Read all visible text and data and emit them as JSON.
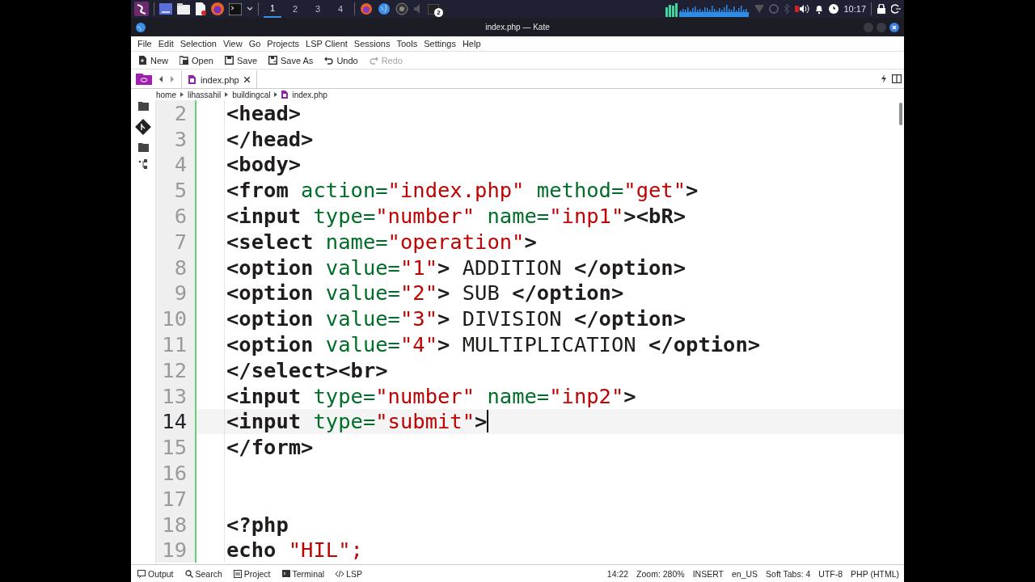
{
  "taskbar": {
    "workspaces": [
      {
        "label": "1",
        "selected": true
      },
      {
        "label": "2",
        "selected": false
      },
      {
        "label": "3",
        "selected": false
      },
      {
        "label": "4",
        "selected": false
      }
    ],
    "task_badge": "2",
    "clock": "10:17"
  },
  "window": {
    "title": "index.php — Kate"
  },
  "menu": [
    "File",
    "Edit",
    "Selection",
    "View",
    "Go",
    "Projects",
    "LSP Client",
    "Sessions",
    "Tools",
    "Settings",
    "Help"
  ],
  "toolbar": [
    {
      "label": "New",
      "disabled": false
    },
    {
      "label": "Open",
      "disabled": false
    },
    {
      "label": "Save",
      "disabled": false
    },
    {
      "label": "Save As",
      "disabled": false
    },
    {
      "label": "Undo",
      "disabled": false
    },
    {
      "label": "Redo",
      "disabled": true
    }
  ],
  "tabs": [
    {
      "label": "index.php",
      "selected": true
    }
  ],
  "breadcrumb": [
    "home",
    "lihassahil",
    "buildingcal",
    "index.php"
  ],
  "editor": {
    "lines": [
      {
        "number": "2",
        "current": false,
        "tokens": [
          {
            "kind": "tag",
            "text": "<head>"
          }
        ]
      },
      {
        "number": "3",
        "current": false,
        "tokens": [
          {
            "kind": "tag",
            "text": "</head>"
          }
        ]
      },
      {
        "number": "4",
        "current": false,
        "tokens": [
          {
            "kind": "tag",
            "text": "<body>"
          }
        ]
      },
      {
        "number": "5",
        "current": false,
        "tokens": [
          {
            "kind": "tag",
            "text": "<from"
          },
          {
            "kind": "attr",
            "text": " action="
          },
          {
            "kind": "str",
            "text": "\"index.php\""
          },
          {
            "kind": "attr",
            "text": " method="
          },
          {
            "kind": "str",
            "text": "\"get\""
          },
          {
            "kind": "tag",
            "text": ">"
          }
        ]
      },
      {
        "number": "6",
        "current": false,
        "tokens": [
          {
            "kind": "tag",
            "text": "<input"
          },
          {
            "kind": "attr",
            "text": " type="
          },
          {
            "kind": "str",
            "text": "\"number\""
          },
          {
            "kind": "attr",
            "text": " name="
          },
          {
            "kind": "str",
            "text": "\"inp1\""
          },
          {
            "kind": "tag",
            "text": "><bR>"
          }
        ]
      },
      {
        "number": "7",
        "current": false,
        "tokens": [
          {
            "kind": "tag",
            "text": "<select"
          },
          {
            "kind": "attr",
            "text": " name="
          },
          {
            "kind": "str",
            "text": "\"operation\""
          },
          {
            "kind": "tag",
            "text": ">"
          }
        ]
      },
      {
        "number": "8",
        "current": false,
        "tokens": [
          {
            "kind": "tag",
            "text": "<option"
          },
          {
            "kind": "attr",
            "text": " value="
          },
          {
            "kind": "str",
            "text": "\"1\""
          },
          {
            "kind": "tag",
            "text": ">"
          },
          {
            "kind": "text",
            "text": " ADDITION "
          },
          {
            "kind": "tag",
            "text": "</option>"
          }
        ]
      },
      {
        "number": "9",
        "current": false,
        "tokens": [
          {
            "kind": "tag",
            "text": "<option"
          },
          {
            "kind": "attr",
            "text": " value="
          },
          {
            "kind": "str",
            "text": "\"2\""
          },
          {
            "kind": "tag",
            "text": ">"
          },
          {
            "kind": "text",
            "text": " SUB "
          },
          {
            "kind": "tag",
            "text": "</option>"
          }
        ]
      },
      {
        "number": "10",
        "current": false,
        "tokens": [
          {
            "kind": "tag",
            "text": "<option"
          },
          {
            "kind": "attr",
            "text": " value="
          },
          {
            "kind": "str",
            "text": "\"3\""
          },
          {
            "kind": "tag",
            "text": ">"
          },
          {
            "kind": "text",
            "text": " DIVISION "
          },
          {
            "kind": "tag",
            "text": "</option>"
          }
        ]
      },
      {
        "number": "11",
        "current": false,
        "tokens": [
          {
            "kind": "tag",
            "text": "<option"
          },
          {
            "kind": "attr",
            "text": " value="
          },
          {
            "kind": "str",
            "text": "\"4\""
          },
          {
            "kind": "tag",
            "text": ">"
          },
          {
            "kind": "text",
            "text": " MULTIPLICATION "
          },
          {
            "kind": "tag",
            "text": "</option>"
          }
        ]
      },
      {
        "number": "12",
        "current": false,
        "tokens": [
          {
            "kind": "tag",
            "text": "</select><br>"
          }
        ]
      },
      {
        "number": "13",
        "current": false,
        "tokens": [
          {
            "kind": "tag",
            "text": "<input"
          },
          {
            "kind": "attr",
            "text": " type="
          },
          {
            "kind": "str",
            "text": "\"number\""
          },
          {
            "kind": "attr",
            "text": " name="
          },
          {
            "kind": "str",
            "text": "\"inp2\""
          },
          {
            "kind": "tag",
            "text": ">"
          }
        ]
      },
      {
        "number": "14",
        "current": true,
        "tokens": [
          {
            "kind": "tag",
            "text": "<input"
          },
          {
            "kind": "attr",
            "text": " type="
          },
          {
            "kind": "str",
            "text": "\"submit\""
          },
          {
            "kind": "tag",
            "text": ">"
          }
        ]
      },
      {
        "number": "15",
        "current": false,
        "tokens": [
          {
            "kind": "tag",
            "text": "</form>"
          }
        ]
      },
      {
        "number": "16",
        "current": false
      },
      {
        "number": "17",
        "current": false
      },
      {
        "number": "18",
        "current": false,
        "tokens": [
          {
            "kind": "tag",
            "text": "<?php"
          }
        ]
      },
      {
        "number": "19",
        "current": false,
        "tokens": [
          {
            "kind": "tag",
            "text": "echo "
          },
          {
            "kind": "str",
            "text": "\"HIL\";"
          }
        ]
      }
    ]
  },
  "bottom_tabs": [
    "Output",
    "Search",
    "Project",
    "Terminal",
    "LSP"
  ],
  "status": [
    "14:22",
    "Zoom: 280%",
    "INSERT",
    "en_US",
    "Soft Tabs: 4",
    "UTF-8",
    "PHP (HTML)"
  ]
}
